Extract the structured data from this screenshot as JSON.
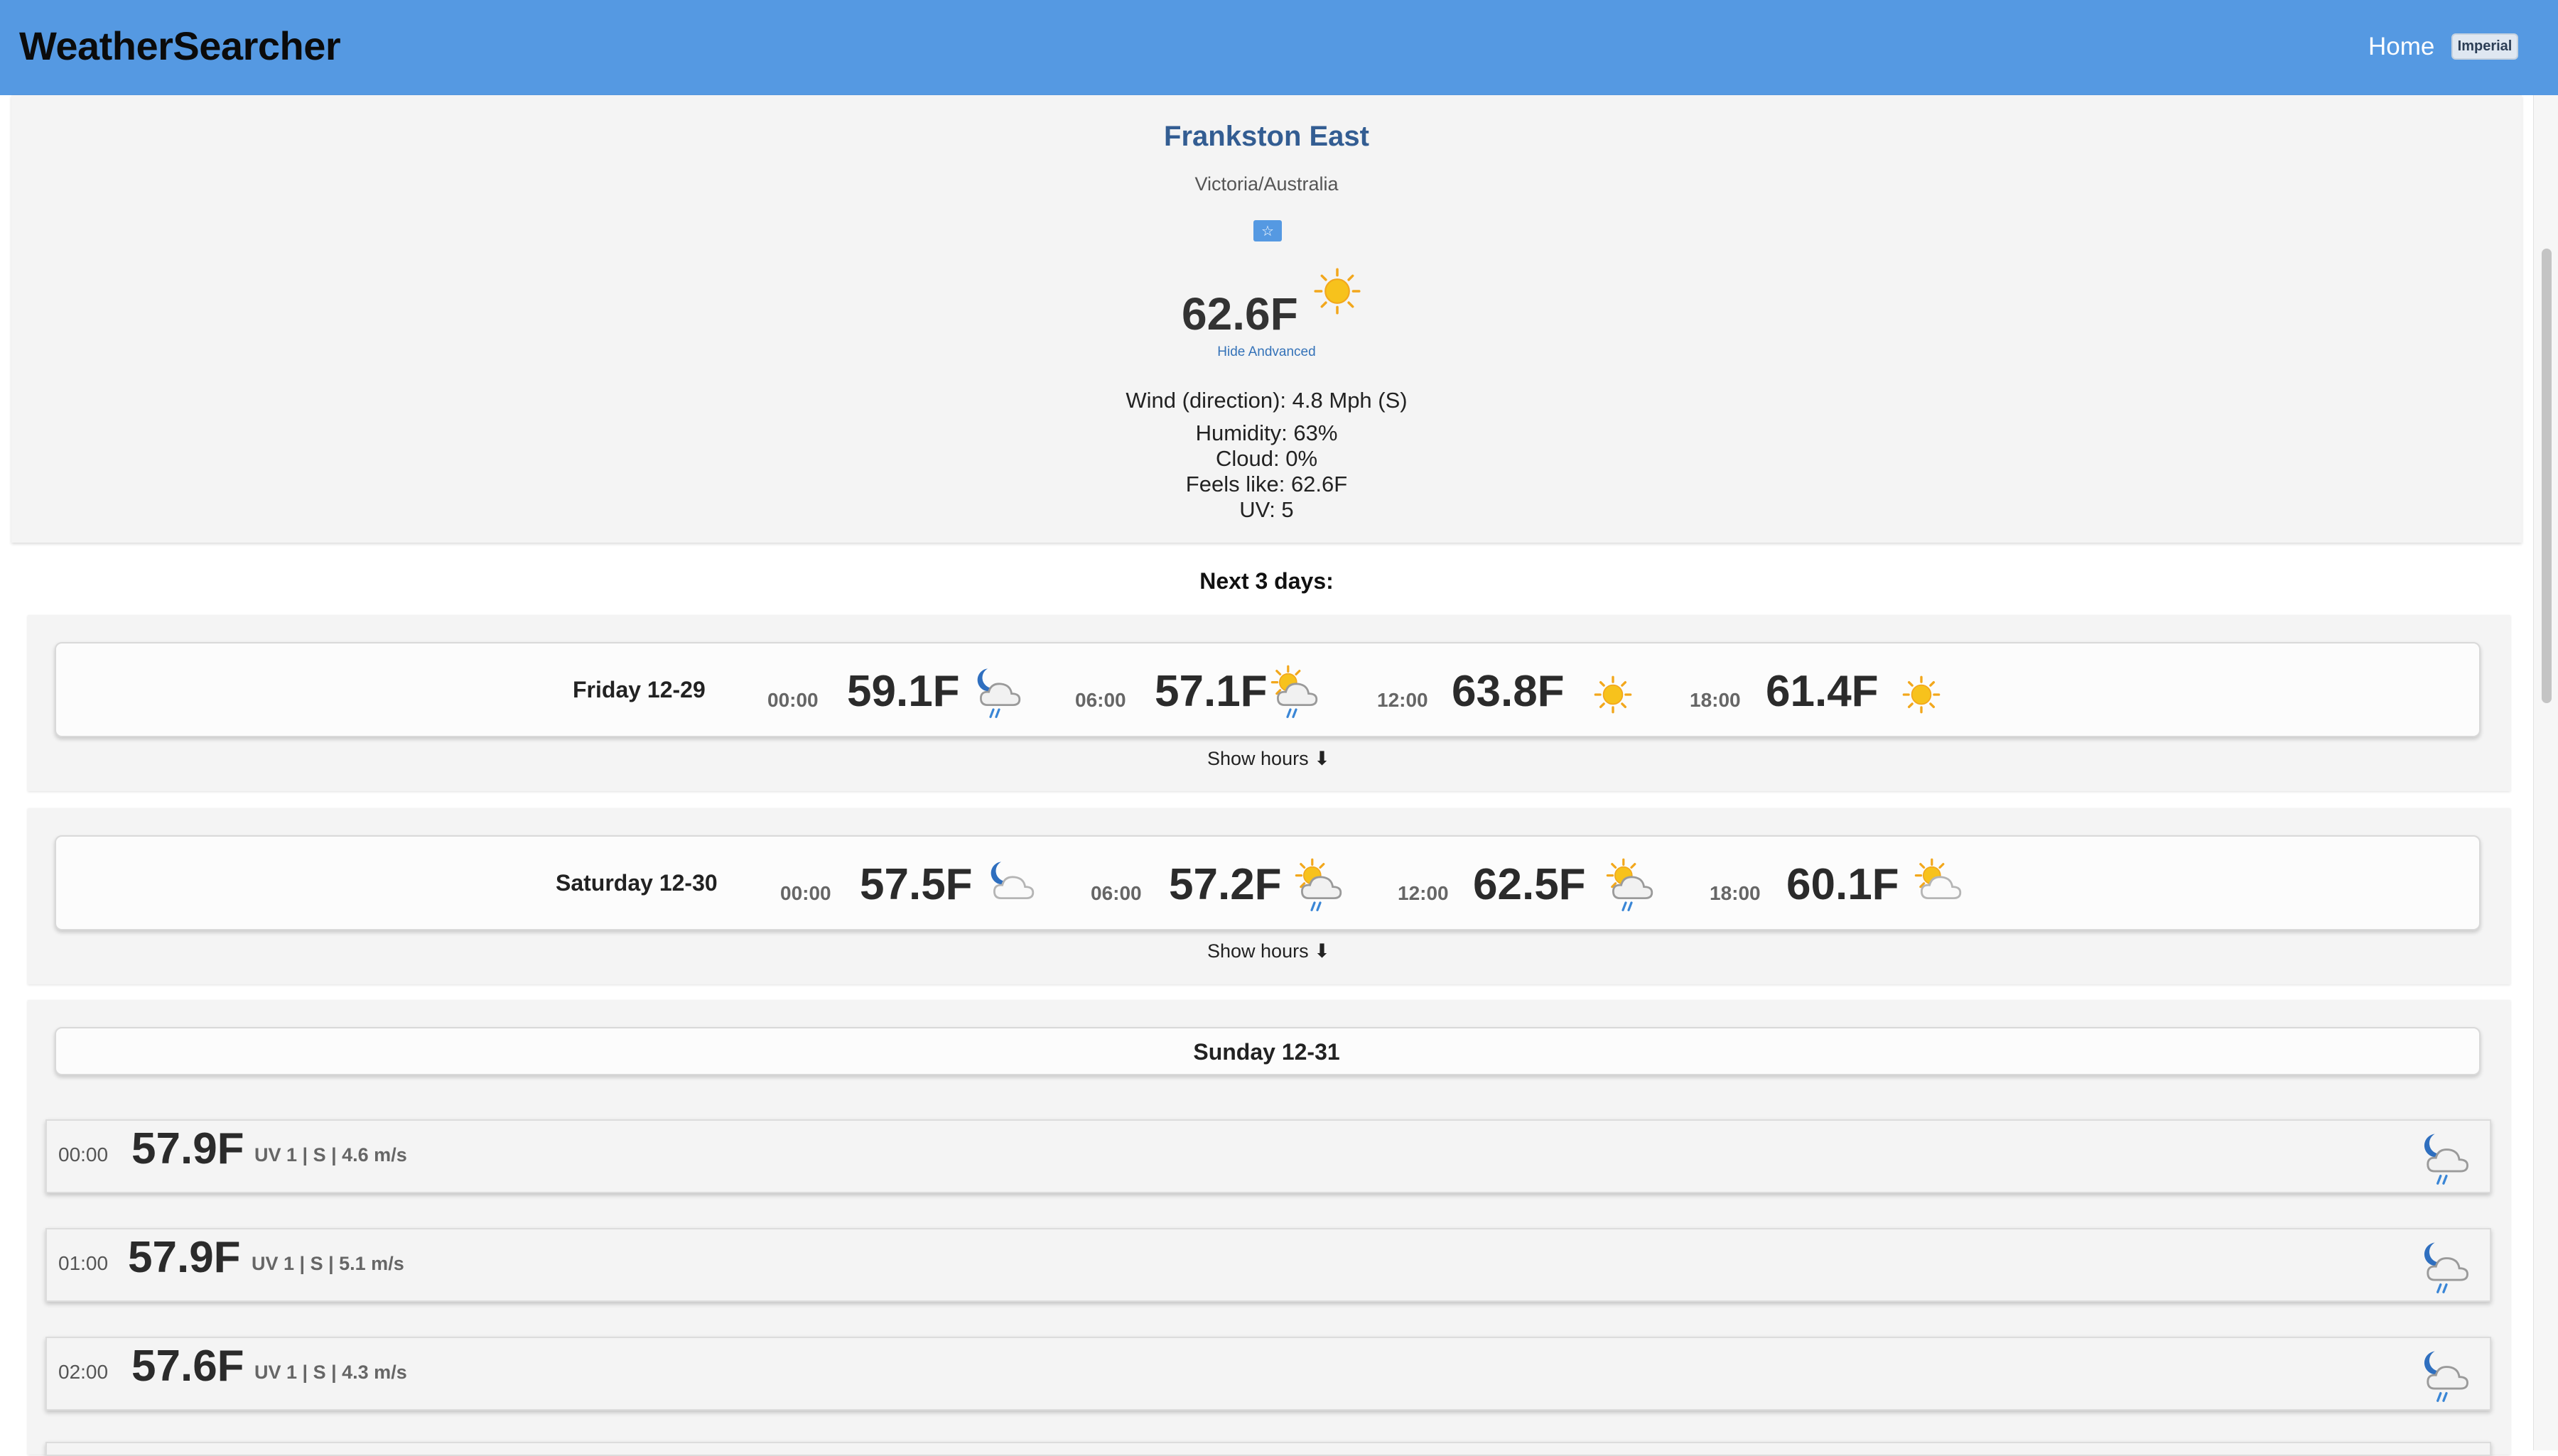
{
  "app": {
    "brand": "WeatherSearcher",
    "nav_home": "Home",
    "unit_toggle": "Imperial"
  },
  "current": {
    "city": "Frankston East",
    "region": "Victoria/Australia",
    "favorite_icon": "star-icon",
    "temperature": "62.6F",
    "condition_icon": "sun-icon",
    "advanced_toggle": "Hide Andvanced",
    "wind": "Wind (direction): 4.8 Mph (S)",
    "humidity": "Humidity:  63%",
    "cloud": "Cloud:  0%",
    "feels_like": "Feels like:  62.6F",
    "uv": "UV:  5"
  },
  "forecast_heading": "Next 3 days:",
  "days": [
    {
      "title": "Friday 12-29",
      "show_hours": "Show hours ⬇",
      "slots": [
        {
          "time": "00:00",
          "temp": "59.1F",
          "icon": "moon-cloud-rain-icon"
        },
        {
          "time": "06:00",
          "temp": "57.1F",
          "icon": "sun-cloud-rain-icon"
        },
        {
          "time": "12:00",
          "temp": "63.8F",
          "icon": "sun-icon"
        },
        {
          "time": "18:00",
          "temp": "61.4F",
          "icon": "sun-icon"
        }
      ]
    },
    {
      "title": "Saturday 12-30",
      "show_hours": "Show hours ⬇",
      "slots": [
        {
          "time": "00:00",
          "temp": "57.5F",
          "icon": "moon-cloud-icon"
        },
        {
          "time": "06:00",
          "temp": "57.2F",
          "icon": "sun-cloud-rain-icon"
        },
        {
          "time": "12:00",
          "temp": "62.5F",
          "icon": "sun-cloud-rain-icon"
        },
        {
          "time": "18:00",
          "temp": "60.1F",
          "icon": "sun-cloud-icon"
        }
      ]
    },
    {
      "title": "Sunday 12-31",
      "hours": [
        {
          "time": "00:00",
          "temp": "57.9F",
          "meta": "UV 1 | S | 4.6 m/s",
          "icon": "moon-cloud-rain-icon"
        },
        {
          "time": "01:00",
          "temp": "57.9F",
          "meta": "UV 1 | S | 5.1 m/s",
          "icon": "moon-cloud-rain-icon"
        },
        {
          "time": "02:00",
          "temp": "57.6F",
          "meta": "UV 1 | S | 4.3 m/s",
          "icon": "moon-cloud-rain-icon"
        }
      ]
    }
  ],
  "colors": {
    "topbar": "#5599e2",
    "city_name": "#335d92",
    "link": "#3472b8",
    "sun": "#f7c21c",
    "moon": "#2f6fbf",
    "rain": "#3a86d6"
  }
}
